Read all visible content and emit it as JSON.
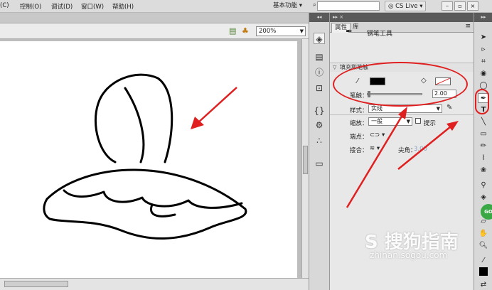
{
  "menu": {
    "items": [
      "控制(O)",
      "调试(D)",
      "窗口(W)",
      "帮助(H)"
    ],
    "partial_item": "(C)",
    "workspace": "基本功能",
    "search_placeholder": "",
    "cs_live": "CS Live"
  },
  "editbar": {
    "zoom": "200%"
  },
  "panel": {
    "header": "▸▸  ×",
    "tabs": [
      "属性",
      "库"
    ],
    "tool_name": "钢笔工具",
    "section": "填充和笔触",
    "stroke_label": "笔触：",
    "stroke_value": "2.00",
    "style_label": "样式：",
    "style_value": "实线",
    "scale_label": "缩放：",
    "scale_value": "一般",
    "hint_label": "提示",
    "cap_label": "端点：",
    "join_label": "接合：",
    "miter_label": "尖角：",
    "miter_value": "3.00"
  },
  "watermark": {
    "logo": "S 搜狗指南",
    "url": "zhinan.sogou.com"
  },
  "colors": {
    "annotation": "#e02020",
    "stroke": "#000000",
    "fill": "#ffffff",
    "panel_bg": "#e8e8e8"
  }
}
